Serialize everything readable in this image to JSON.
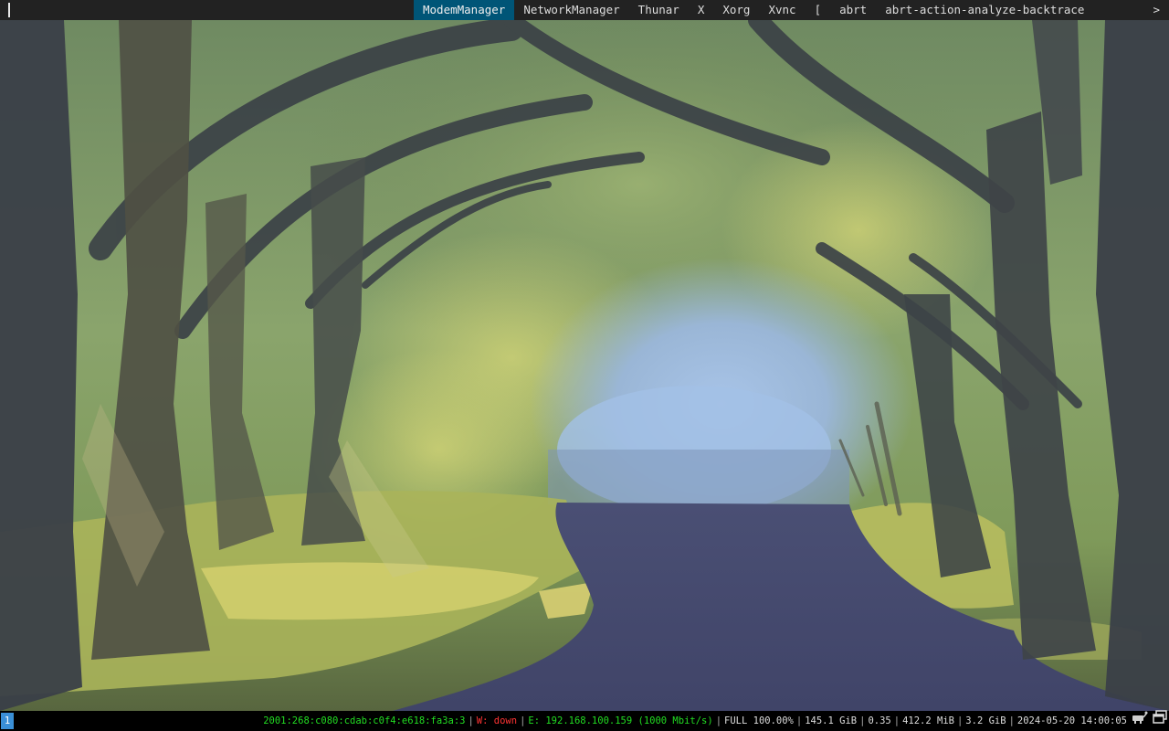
{
  "topbar": {
    "windows": [
      {
        "label": "ModemManager",
        "active": true
      },
      {
        "label": "NetworkManager",
        "active": false
      },
      {
        "label": "Thunar",
        "active": false
      },
      {
        "label": "X",
        "active": false
      },
      {
        "label": "Xorg",
        "active": false
      },
      {
        "label": "Xvnc",
        "active": false
      },
      {
        "label": "[",
        "active": false
      },
      {
        "label": "abrt",
        "active": false
      },
      {
        "label": "abrt-action-analyze-backtrace",
        "active": false
      }
    ],
    "scroll_indicator": ">",
    "colors": {
      "background": "#222222",
      "active": "#005577",
      "text": "#dddddd"
    }
  },
  "bottombar": {
    "tag": "1",
    "status": {
      "ipv6": "2001:268:c080:cdab:c0f4:e618:fa3a:3",
      "wireless": "W: down",
      "ethernet": "E: 192.168.100.159 (1000 Mbit/s)",
      "battery": "FULL 100.00%",
      "disk": "145.1 GiB",
      "load": "0.35",
      "memory_used": "412.2 MiB",
      "memory_avail": "3.2 GiB",
      "datetime": "2024-05-20 14:00:05"
    },
    "tray_icons": [
      "network-wired-icon",
      "window-icon"
    ],
    "colors": {
      "good": "#22dd22",
      "bad": "#ff3333",
      "tag_bg": "#3a8fd6"
    }
  },
  "wallpaper": {
    "subject": "painted-forest-path-icon"
  }
}
